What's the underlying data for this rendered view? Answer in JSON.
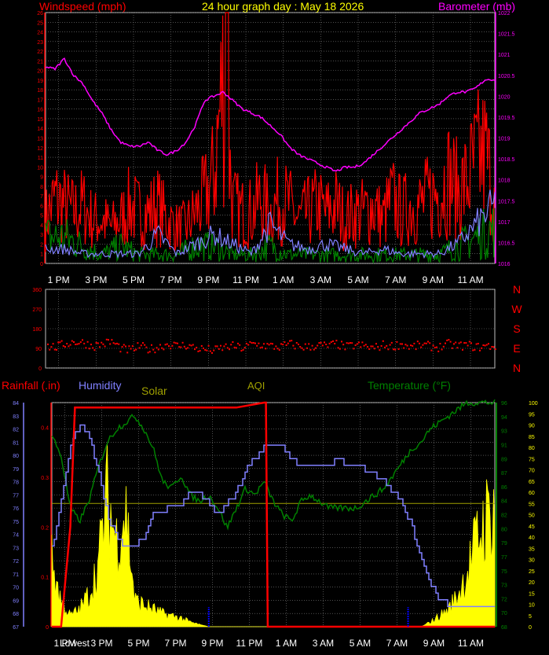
{
  "window": {
    "title": "24 hour graph day : May 18 2026"
  },
  "colors": {
    "windspeed": "#ff0000",
    "windgust": "#ff0000",
    "windavg": "#008000",
    "barometer": "#ff00ff",
    "humidity": "#8080ff",
    "temperature": "#008000",
    "rainfall": "#ff0000",
    "solar": "#ffff00",
    "solar_label": "#a0a000",
    "aqi": "#a0a000",
    "direction": "#ff0000",
    "grid": "#808080"
  },
  "chart_data": [
    {
      "type": "line",
      "panel": "wind-barometer",
      "title": "24 hour graph day : May 18 2026",
      "ylabel_left": "Windspeed (mph)",
      "ylabel_right": "Barometer (mb)",
      "x_ticks": [
        "1 PM",
        "3 PM",
        "5 PM",
        "7 PM",
        "9 PM",
        "11 PM",
        "1 AM",
        "3 AM",
        "5 AM",
        "7 AM",
        "9 AM",
        "11 AM"
      ],
      "y_left_ticks": [
        "0",
        "1",
        "2",
        "3",
        "4",
        "5",
        "6",
        "7",
        "8",
        "9",
        "10",
        "11",
        "12",
        "13",
        "14",
        "15",
        "16",
        "17",
        "18",
        "19",
        "20",
        "21",
        "22",
        "23",
        "24",
        "25",
        "26"
      ],
      "y_right_ticks": [
        "1016",
        "1016.5",
        "1017",
        "1017.5",
        "1018",
        "1018.5",
        "1019",
        "1019.5",
        "1020",
        "1020.5",
        "1021",
        "1021.5",
        "1022"
      ],
      "ylim_left": [
        0,
        26
      ],
      "ylim_right": [
        1016,
        1022
      ],
      "grid": true,
      "series": [
        {
          "name": "Barometer (mb)",
          "axis": "right",
          "color": "#ff00ff",
          "x": [
            0,
            0.5,
            1,
            1.5,
            2,
            2.5,
            3,
            3.5,
            4,
            4.5,
            5,
            5.5,
            6,
            6.5,
            7,
            7.5,
            8,
            8.5,
            9,
            9.5,
            10,
            10.5,
            11,
            11.5,
            12,
            12.5,
            13,
            13.5,
            14,
            14.5,
            15,
            15.5,
            16,
            16.5,
            17,
            17.5,
            18,
            18.5,
            19,
            19.5,
            20,
            20.5,
            21,
            21.5,
            22,
            22.5,
            23,
            23.5,
            24
          ],
          "values": [
            1020.7,
            1020.65,
            1020.9,
            1020.5,
            1020.3,
            1019.9,
            1019.6,
            1019.2,
            1018.9,
            1018.8,
            1018.8,
            1018.9,
            1018.7,
            1018.6,
            1018.7,
            1018.9,
            1019.3,
            1019.9,
            1020.0,
            1020.1,
            1019.9,
            1019.7,
            1019.6,
            1019.5,
            1019.3,
            1019.1,
            1018.8,
            1018.6,
            1018.5,
            1018.4,
            1018.3,
            1018.2,
            1018.3,
            1018.3,
            1018.4,
            1018.6,
            1018.8,
            1019.0,
            1019.2,
            1019.4,
            1019.6,
            1019.7,
            1019.8,
            1020.0,
            1020.1,
            1020.1,
            1020.2,
            1020.4,
            1020.4
          ]
        },
        {
          "name": "Wind gust",
          "axis": "left",
          "color": "#ff0000",
          "x": [
            0,
            0.5,
            1,
            1.5,
            2,
            2.5,
            3,
            3.5,
            4,
            4.5,
            5,
            5.5,
            6,
            6.5,
            7,
            7.5,
            8,
            8.5,
            9,
            9.5,
            10,
            10.5,
            11,
            11.5,
            12,
            12.5,
            13,
            13.5,
            14,
            14.5,
            15,
            15.5,
            16,
            16.5,
            17,
            17.5,
            18,
            18.5,
            19,
            19.5,
            20,
            20.5,
            21,
            21.5,
            22,
            22.5,
            23,
            23.5,
            24
          ],
          "values": [
            6,
            9,
            8,
            7,
            8,
            6,
            6,
            5,
            6,
            8,
            7,
            7,
            8,
            6,
            5,
            5,
            7,
            9,
            12,
            26,
            8,
            7,
            7,
            9,
            7,
            9,
            8,
            6,
            7,
            8,
            7,
            8,
            6,
            7,
            7,
            8,
            6,
            9,
            7,
            8,
            8,
            9,
            10,
            12,
            10,
            11,
            14,
            15,
            9
          ]
        },
        {
          "name": "Wind average",
          "axis": "left",
          "color": "#008000",
          "x": [
            0,
            1,
            2,
            3,
            4,
            5,
            6,
            7,
            8,
            9,
            10,
            11,
            12,
            13,
            14,
            15,
            16,
            17,
            18,
            19,
            20,
            21,
            22,
            23,
            24
          ],
          "values": [
            3,
            3,
            2,
            1,
            2,
            1,
            1,
            1,
            2,
            2,
            1,
            1,
            2,
            1,
            1,
            1,
            1,
            1,
            1,
            1,
            1,
            1,
            2,
            3,
            4
          ]
        },
        {
          "name": "Wind speed",
          "axis": "left",
          "color": "#8080ff",
          "x": [
            0,
            1,
            2,
            3,
            4,
            5,
            6,
            7,
            8,
            9,
            10,
            11,
            12,
            13,
            14,
            15,
            16,
            17,
            18,
            19,
            20,
            21,
            22,
            23,
            24
          ],
          "values": [
            1.5,
            1.5,
            1,
            1,
            1,
            1,
            3,
            1,
            2,
            3,
            2,
            1,
            4,
            2,
            1.5,
            2,
            1.5,
            1,
            1.5,
            1,
            1,
            1,
            2,
            4,
            6
          ]
        }
      ]
    },
    {
      "type": "scatter",
      "panel": "wind-direction",
      "y_left_ticks": [
        "360",
        "270",
        "180",
        "90",
        "0"
      ],
      "y_right_labels": [
        "N",
        "W",
        "S",
        "E",
        "N"
      ],
      "ylim": [
        0,
        360
      ],
      "grid": true,
      "series": [
        {
          "name": "Wind direction",
          "color": "#ff0000",
          "x": [
            0,
            0.5,
            1,
            1.5,
            2,
            2.5,
            3,
            3.5,
            4,
            4.5,
            5,
            5.5,
            6,
            6.5,
            7,
            7.5,
            8,
            8.5,
            9,
            9.5,
            10,
            10.5,
            11,
            11.5,
            12,
            12.5,
            13,
            13.5,
            14,
            14.5,
            15,
            15.5,
            16,
            16.5,
            17,
            17.5,
            18,
            18.5,
            19,
            19.5,
            20,
            20.5,
            21,
            21.5,
            22,
            22.5,
            23,
            23.5,
            24
          ],
          "values": [
            100,
            95,
            110,
            120,
            115,
            100,
            110,
            120,
            90,
            80,
            100,
            85,
            95,
            110,
            100,
            105,
            90,
            85,
            80,
            95,
            100,
            90,
            110,
            105,
            100,
            95,
            110,
            100,
            95,
            105,
            100,
            110,
            95,
            105,
            100,
            90,
            105,
            100,
            110,
            95,
            105,
            100,
            95,
            110,
            100,
            105,
            95,
            100,
            100
          ]
        }
      ]
    },
    {
      "type": "line",
      "panel": "temp-humidity-rain-solar",
      "legend": [
        "Rainfall (.in)",
        "Humidity",
        "Solar",
        "AQI",
        "Temperature (°F)"
      ],
      "x_ticks": [
        "Lowest",
        "1 PM",
        "3 PM",
        "5 PM",
        "7 PM",
        "9 PM",
        "11 PM",
        "1 AM",
        "3 AM",
        "5 AM",
        "7 AM",
        "9 AM",
        "11 AM"
      ],
      "y_left_ticks": [
        "67",
        "68",
        "69",
        "70",
        "71",
        "72",
        "73",
        "74",
        "75",
        "76",
        "77",
        "78",
        "79",
        "80",
        "81",
        "82",
        "83",
        "84"
      ],
      "y_right_ticks": [
        "0",
        "5",
        "10",
        "15",
        "20",
        "25",
        "30",
        "35",
        "40",
        "45",
        "50",
        "55",
        "60",
        "65",
        "70",
        "75",
        "80",
        "85",
        "90",
        "95",
        "100"
      ],
      "y_rain_ticks": [
        "0",
        "0.1",
        "0.2",
        "0.3",
        "0.4"
      ],
      "ylim_temp": [
        67,
        84
      ],
      "ylim_right": [
        0,
        100
      ],
      "ylim_rain": [
        0,
        0.45
      ],
      "grid": true,
      "series": [
        {
          "name": "Temperature (°F)",
          "axis": "left",
          "color": "#008000",
          "x": [
            0,
            0.5,
            1,
            1.5,
            2,
            2.5,
            3,
            3.5,
            4,
            4.5,
            5,
            5.5,
            6,
            6.5,
            7,
            7.5,
            8,
            8.5,
            9,
            9.5,
            10,
            10.5,
            11,
            11.5,
            12,
            12.5,
            13,
            13.5,
            14,
            14.5,
            15,
            15.5,
            16,
            16.5,
            17,
            17.5,
            18,
            18.5,
            19,
            19.5,
            20,
            20.5,
            21,
            21.5,
            22,
            22.5,
            23,
            23.5,
            24
          ],
          "values": [
            81.5,
            80,
            76,
            75,
            76.5,
            79,
            81,
            82,
            82.5,
            83,
            82,
            80.5,
            78,
            77.5,
            78.5,
            77,
            76.5,
            77,
            76,
            74.5,
            76,
            77.5,
            77,
            78,
            76.5,
            75.5,
            75,
            76.5,
            77,
            76.5,
            76,
            76,
            76,
            76,
            76.5,
            77,
            77.5,
            78.5,
            79.5,
            80.5,
            81,
            82,
            82.5,
            83,
            83.5,
            84,
            84,
            84,
            84
          ]
        },
        {
          "name": "Humidity",
          "axis": "right",
          "color": "#8080ff",
          "x": [
            0,
            0.5,
            1,
            1.5,
            2,
            2.5,
            3,
            3.5,
            4,
            4.5,
            5,
            5.5,
            6,
            6.5,
            7,
            7.5,
            8,
            8.5,
            9,
            9.5,
            10,
            10.5,
            11,
            11.5,
            12,
            12.5,
            13,
            13.5,
            14,
            14.5,
            15,
            15.5,
            16,
            16.5,
            17,
            17.5,
            18,
            18.5,
            19,
            19.5,
            20,
            20.5,
            21,
            21.5,
            22,
            22.5,
            23,
            23.5,
            24
          ],
          "values": [
            35,
            55,
            80,
            90,
            86,
            70,
            50,
            40,
            35,
            36,
            40,
            50,
            50,
            55,
            55,
            60,
            60,
            55,
            50,
            55,
            60,
            70,
            75,
            80,
            82,
            80,
            75,
            72,
            72,
            72,
            72,
            75,
            72,
            72,
            70,
            68,
            65,
            60,
            55,
            45,
            30,
            20,
            12,
            10,
            10,
            10,
            10,
            10,
            10
          ]
        },
        {
          "name": "Solar",
          "axis": "right",
          "color": "#ffff00",
          "x": [
            0,
            0.5,
            1,
            1.5,
            2,
            2.5,
            3,
            3.5,
            4,
            4.5,
            5,
            5.5,
            6,
            6.5,
            7,
            7.5,
            8,
            8.5,
            9,
            9.5,
            10,
            10.5,
            11,
            11.5,
            12,
            12.5,
            13,
            13.5,
            14,
            14.5,
            15,
            15.5,
            16,
            16.5,
            17,
            17.5,
            18,
            18.5,
            19,
            19.5,
            20,
            20.5,
            21,
            21.5,
            22,
            22.5,
            23,
            23.5,
            24
          ],
          "values": [
            30,
            12,
            5,
            8,
            15,
            28,
            60,
            40,
            55,
            12,
            10,
            8,
            6,
            5,
            4,
            2,
            1,
            0,
            0,
            0,
            0,
            0,
            0,
            0,
            0,
            0,
            0,
            0,
            0,
            0,
            0,
            0,
            0,
            0,
            0,
            0,
            0,
            0,
            0,
            0,
            0,
            2,
            5,
            8,
            15,
            25,
            40,
            50,
            55
          ]
        },
        {
          "name": "AQI",
          "axis": "right",
          "color": "#a0a000",
          "x": [
            0,
            24
          ],
          "values": [
            55,
            55
          ]
        },
        {
          "name": "Rainfall (.in)",
          "axis": "rain",
          "color": "#ff0000",
          "x": [
            0,
            0.5,
            1,
            1.25,
            1.5,
            10,
            11.5,
            11.6,
            11.7,
            24
          ],
          "values": [
            0,
            0,
            0.2,
            0.44,
            0.44,
            0.44,
            0.45,
            0.45,
            0,
            0
          ]
        }
      ]
    }
  ]
}
